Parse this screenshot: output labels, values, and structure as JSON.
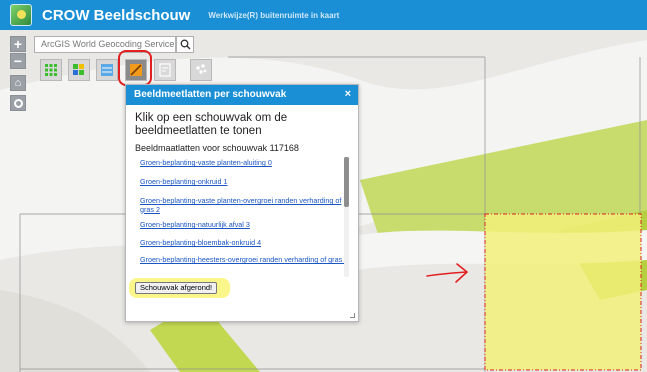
{
  "header": {
    "title": "CROW Beeldschouw",
    "subtitle": "Werkwijze(R) buitenruimte in kaart",
    "logo_icon": "crow-app-logo-icon"
  },
  "controls": {
    "zoom_in": "+",
    "zoom_out": "−",
    "home": "⌂"
  },
  "search": {
    "placeholder": "ArcGIS World Geocoding Service",
    "button_icon": "search-icon"
  },
  "toolbar": {
    "tools": [
      {
        "name": "grid-green-tool-icon",
        "active": false
      },
      {
        "name": "grid-mixed-tool-icon",
        "active": false
      },
      {
        "name": "list-tool-icon",
        "active": false
      },
      {
        "name": "measure-ruler-tool-icon",
        "active": true
      },
      {
        "name": "edit-form-tool-icon",
        "active": false
      },
      {
        "name": "points-tool-icon",
        "active": false
      }
    ]
  },
  "popup": {
    "title": "Beeldmeetlatten per schouwvak",
    "close_label": "×",
    "instruction": "Klik op een schouwvak om de beeldmeetlatten te tonen",
    "caption": "Beeldmaatlatten voor schouwvak 117168",
    "links": [
      "Groen-beplanting-vaste planten-aluiting 0",
      "Groen-beplanting-onkruid 1",
      "Groen-beplanting-vaste planten-overgroei randen verharding of gras 2",
      "Groen-beplanting-natuurlijk afval 3",
      "Groen-beplanting-bloembak-onkruid 4",
      "Groen-beplanting-heesters-overgroei randen verharding of gras 5"
    ],
    "done_button": "Schouwvak afgerond!"
  },
  "colors": {
    "header_blue": "#1a8fd6",
    "selection_yellow": "#f2f07a",
    "selection_border": "#d62020",
    "link_blue": "#1a55c4",
    "annotation_red": "#e02020"
  }
}
